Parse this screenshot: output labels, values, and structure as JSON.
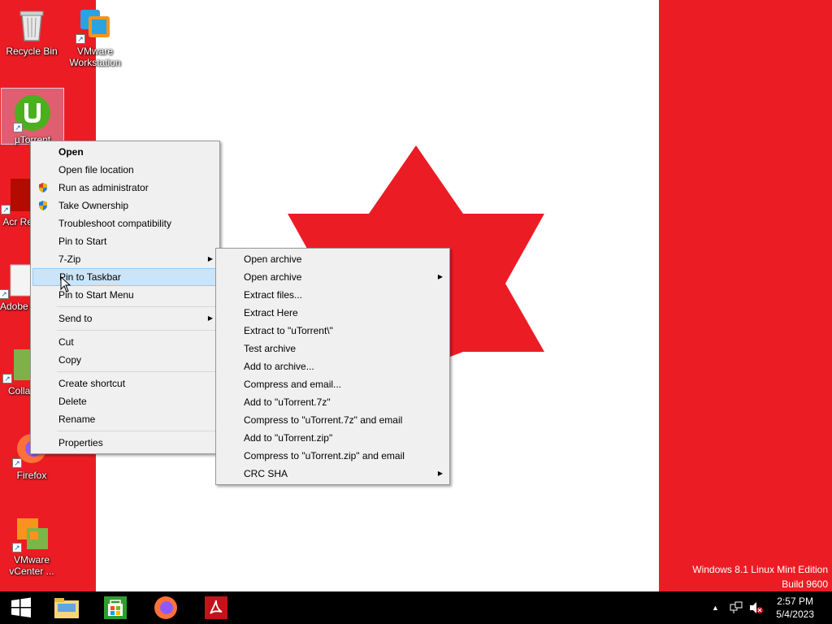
{
  "desktop": {
    "icons": [
      {
        "label": "Recycle Bin",
        "icon": "recycle-bin-icon"
      },
      {
        "label": "VMware Workstation",
        "icon": "vmware-workstation-icon"
      },
      {
        "label": "µTorrent",
        "icon": "utorrent-icon"
      },
      {
        "label": "Acr Rea",
        "icon": "acrobat-reader-icon"
      },
      {
        "label": "Adobe X",
        "icon": "adobe-icon"
      },
      {
        "label": "Collab",
        "icon": "collab-icon"
      },
      {
        "label": "Firefox",
        "icon": "firefox-icon"
      },
      {
        "label": "VMware vCenter ...",
        "icon": "vmware-vcenter-icon"
      }
    ]
  },
  "context_menu": {
    "items": [
      {
        "label": "Open"
      },
      {
        "label": "Open file location"
      },
      {
        "label": "Run as administrator",
        "icon": "uac-shield-icon"
      },
      {
        "label": "Take Ownership",
        "icon": "uac-shield-icon"
      },
      {
        "label": "Troubleshoot compatibility"
      },
      {
        "label": "Pin to Start"
      },
      {
        "label": "7-Zip"
      },
      {
        "label": "Pin to Taskbar"
      },
      {
        "label": "Pin to Start Menu"
      },
      {
        "label": "Send to"
      },
      {
        "label": "Cut"
      },
      {
        "label": "Copy"
      },
      {
        "label": "Create shortcut"
      },
      {
        "label": "Delete"
      },
      {
        "label": "Rename"
      },
      {
        "label": "Properties"
      }
    ],
    "hovered_item": "Pin to Taskbar"
  },
  "submenu_7zip": {
    "items": [
      {
        "label": "Open archive"
      },
      {
        "label": "Open archive"
      },
      {
        "label": "Extract files..."
      },
      {
        "label": "Extract Here"
      },
      {
        "label": "Extract to \"uTorrent\\\""
      },
      {
        "label": "Test archive"
      },
      {
        "label": "Add to archive..."
      },
      {
        "label": "Compress and email..."
      },
      {
        "label": "Add to \"uTorrent.7z\""
      },
      {
        "label": "Compress to \"uTorrent.7z\" and email"
      },
      {
        "label": "Add to \"uTorrent.zip\""
      },
      {
        "label": "Compress to \"uTorrent.zip\" and email"
      },
      {
        "label": "CRC SHA"
      }
    ]
  },
  "watermark": {
    "line1": "Windows 8.1 Linux Mint Edition",
    "line2": "Build 9600"
  },
  "taskbar": {
    "pinned": [
      "start-icon",
      "file-explorer-icon",
      "store-icon",
      "firefox-icon",
      "acrobat-icon"
    ],
    "clock_time": "2:57 PM",
    "clock_date": "5/4/2023"
  },
  "colors": {
    "wallpaper_red": "#ec1c24",
    "wallpaper_white": "#ffffff",
    "menu_bg": "#f0f0f0",
    "menu_hover": "#cce4f7",
    "taskbar": "#000000"
  }
}
